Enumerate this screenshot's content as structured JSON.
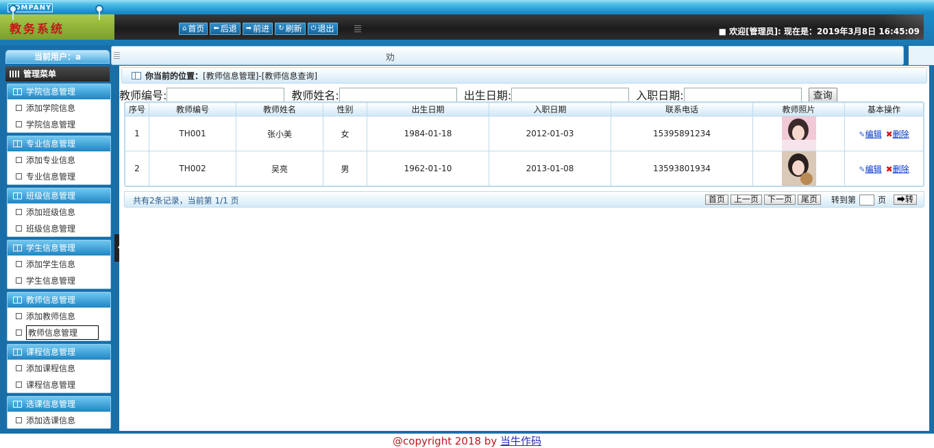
{
  "header": {
    "company": "COMPANY",
    "system_title": "教务系统",
    "nav": [
      {
        "icon": "home-icon",
        "glyph": "⌂",
        "label": "首页"
      },
      {
        "icon": "back-arrow-icon",
        "glyph": "⬅",
        "label": "后退"
      },
      {
        "icon": "forward-arrow-icon",
        "glyph": "➡",
        "label": "前进"
      },
      {
        "icon": "refresh-icon",
        "glyph": "↻",
        "label": "刷新"
      },
      {
        "icon": "power-icon",
        "glyph": "⏻",
        "label": "退出"
      }
    ],
    "welcome": "■ 欢迎[管理员]:  现在是：2019年3月8日 16:45:09"
  },
  "sidebar": {
    "current_user": "当前用户：a",
    "menu_title": "管理菜单",
    "groups": [
      {
        "title": "学院信息管理",
        "items": [
          "添加学院信息",
          "学院信息管理"
        ]
      },
      {
        "title": "专业信息管理",
        "items": [
          "添加专业信息",
          "专业信息管理"
        ]
      },
      {
        "title": "班级信息管理",
        "items": [
          "添加班级信息",
          "班级信息管理"
        ]
      },
      {
        "title": "学生信息管理",
        "items": [
          "添加学生信息",
          "学生信息管理"
        ]
      },
      {
        "title": "教师信息管理",
        "items": [
          "添加教师信息",
          "教师信息管理"
        ]
      },
      {
        "title": "课程信息管理",
        "items": [
          "添加课程信息",
          "课程信息管理"
        ]
      },
      {
        "title": "选课信息管理",
        "items": [
          "添加选课信息"
        ]
      }
    ],
    "selected_item": "教师信息管理"
  },
  "tab": {
    "text": "劝"
  },
  "main": {
    "breadcrumb_label": "你当前的位置：",
    "breadcrumb_path": "[教师信息管理]-[教师信息查询]",
    "search": {
      "teacher_no_label": "教师编号:",
      "teacher_name_label": "教师姓名:",
      "birth_label": "出生日期:",
      "hire_label": "入职日期:",
      "query_button": "查询"
    },
    "table": {
      "columns": [
        "序号",
        "教师编号",
        "教师姓名",
        "性别",
        "出生日期",
        "入职日期",
        "联系电话",
        "教师照片",
        "基本操作"
      ],
      "rows": [
        {
          "no": "1",
          "teacher_no": "TH001",
          "name": "张小美",
          "gender": "女",
          "birth": "1984-01-18",
          "hire": "2012-01-03",
          "phone": "15395891234"
        },
        {
          "no": "2",
          "teacher_no": "TH002",
          "name": "吴亮",
          "gender": "男",
          "birth": "1962-01-10",
          "hire": "2013-01-08",
          "phone": "13593801934"
        }
      ],
      "edit_label": "编辑",
      "delete_label": "删除"
    },
    "pager": {
      "info": "共有2条记录，当前第 1/1 页",
      "first": "首页",
      "prev": "上一页",
      "next": "下一页",
      "last": "尾页",
      "goto_label": "转到第",
      "page_unit": "页",
      "go_button": "➡转"
    }
  },
  "footer": {
    "copyright": "@copyright 2018 by ",
    "author": "当牛作码"
  }
}
